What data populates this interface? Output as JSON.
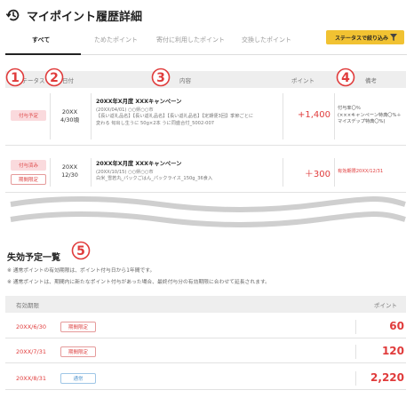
{
  "header": {
    "title": "マイポイント履歴詳細",
    "icon": "history-icon"
  },
  "tabs": [
    {
      "label": "すべて"
    },
    {
      "label": "ためたポイント"
    },
    {
      "label": "寄付に利用したポイント"
    },
    {
      "label": "交換したポイント"
    }
  ],
  "filter_button": {
    "label": "ステータスで絞り込み",
    "icon": "filter-icon"
  },
  "history_table": {
    "headers": {
      "status": "ステータス",
      "date": "日付",
      "content": "内容",
      "points": "ポイント",
      "note": "備考"
    },
    "rows": [
      {
        "badges": [
          "付与予定"
        ],
        "date_line1": "20XX",
        "date_line2": "4/30頃",
        "title": "20XX年X月度 XXXキャンペーン",
        "detail_line1": "(20XX/04/01) ○○県○○市",
        "detail_line2": "【長い返礼品名】【長い返礼品名】【長い返礼品名】【定期便3回】季節ごとに",
        "detail_line3": "変わる 旬出し生うに 50g×2本 うに同盛合付_5002-007",
        "points": "+1,400",
        "note_line1": "付与率〇％",
        "note_line2": "(×××キャンペーン特典〇%＋",
        "note_line3": "マイスデップ特典〇%)"
      },
      {
        "badges": [
          "付与済み",
          "期間限定"
        ],
        "date_line1": "20XX",
        "date_line2": "12/30",
        "title": "20XX年X月度 XXXキャンペーン",
        "detail_line1": "(20XX/10/15) ○○県○○市",
        "detail_line2": "白米_雪若丸_パックごはん_パックライス_150g_36食入",
        "points": "＋300",
        "note_line1": "有効期限20XX/12/31"
      }
    ]
  },
  "markers": [
    "1",
    "2",
    "3",
    "4",
    "5"
  ],
  "expiration": {
    "title": "失効予定一覧",
    "notes": [
      "※ 通常ポイントの有効期限は、ポイント付与日から1年間です。",
      "※ 通常ポイントは、期間内に新たなポイント付与があった場合、最終付与分の有効期限に合わせて延長されます。"
    ],
    "headers": {
      "expiry": "有効期限",
      "points": "ポイント"
    },
    "rows": [
      {
        "date": "20XX/6/30",
        "type": "期間限定",
        "points": "60"
      },
      {
        "date": "20XX/7/31",
        "type": "期間限定",
        "points": "120"
      },
      {
        "date": "20XX/8/31",
        "type": "通常",
        "points": "2,220"
      }
    ]
  },
  "colors": {
    "accent_red": "#e03b3b",
    "filter_yellow": "#f1c232",
    "header_gray": "#eeeeee"
  }
}
